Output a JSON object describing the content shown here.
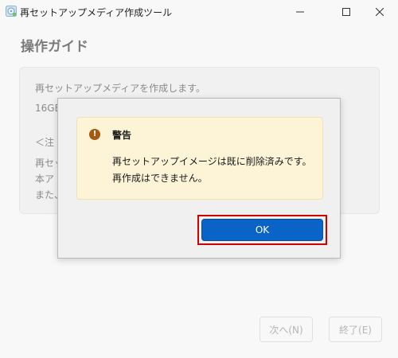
{
  "window": {
    "title": "再セットアップメディア作成ツール",
    "icon": "app-disc-icon"
  },
  "window_controls": {
    "minimize_icon": "minimize-icon",
    "maximize_icon": "maximize-icon",
    "close_icon": "close-icon"
  },
  "page": {
    "title": "操作ガイド",
    "content_lines": [
      "再セットアップメディアを作成します。",
      "16GB",
      "＜注",
      "再セッ",
      "本ア",
      "また、"
    ]
  },
  "footer": {
    "next_label": "次へ(N)",
    "finish_label": "終了(E)"
  },
  "dialog": {
    "warning_title": "警告",
    "warning_icon": "warning-icon",
    "message_line1": "再セットアップイメージは既に削除済みです。",
    "message_line2": "再作成はできません。",
    "ok_label": "OK"
  },
  "colors": {
    "accent": "#0a64c8",
    "warning_bg": "#fdf4d8",
    "warning_icon": "#a45a12",
    "highlight": "#d40000"
  }
}
